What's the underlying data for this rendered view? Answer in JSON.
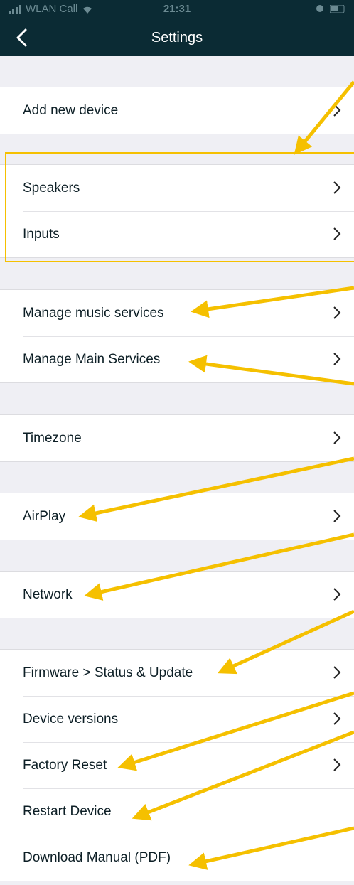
{
  "status_bar": {
    "carrier": "WLAN Call",
    "time": "21:31"
  },
  "nav": {
    "title": "Settings"
  },
  "sections": [
    {
      "top": 0,
      "items": [
        {
          "label": "Add new device",
          "chevron": true
        }
      ]
    },
    {
      "items": [
        {
          "label": "Speakers",
          "chevron": true
        },
        {
          "label": "Inputs",
          "chevron": true
        }
      ]
    },
    {
      "items": [
        {
          "label": "Manage music services",
          "chevron": true
        },
        {
          "label": "Manage Main Services",
          "chevron": true
        }
      ]
    },
    {
      "items": [
        {
          "label": "Timezone",
          "chevron": true
        }
      ]
    },
    {
      "items": [
        {
          "label": "AirPlay",
          "chevron": true
        }
      ]
    },
    {
      "items": [
        {
          "label": "Network",
          "chevron": true
        }
      ]
    },
    {
      "items": [
        {
          "label": "Firmware > Status & Update",
          "chevron": true
        },
        {
          "label": "Device versions",
          "chevron": true
        },
        {
          "label": "Factory Reset",
          "chevron": true
        },
        {
          "label": "Restart Device",
          "chevron": false
        },
        {
          "label": "Download Manual (PDF)",
          "chevron": false
        }
      ]
    }
  ],
  "annotation_color": "#f5c000"
}
